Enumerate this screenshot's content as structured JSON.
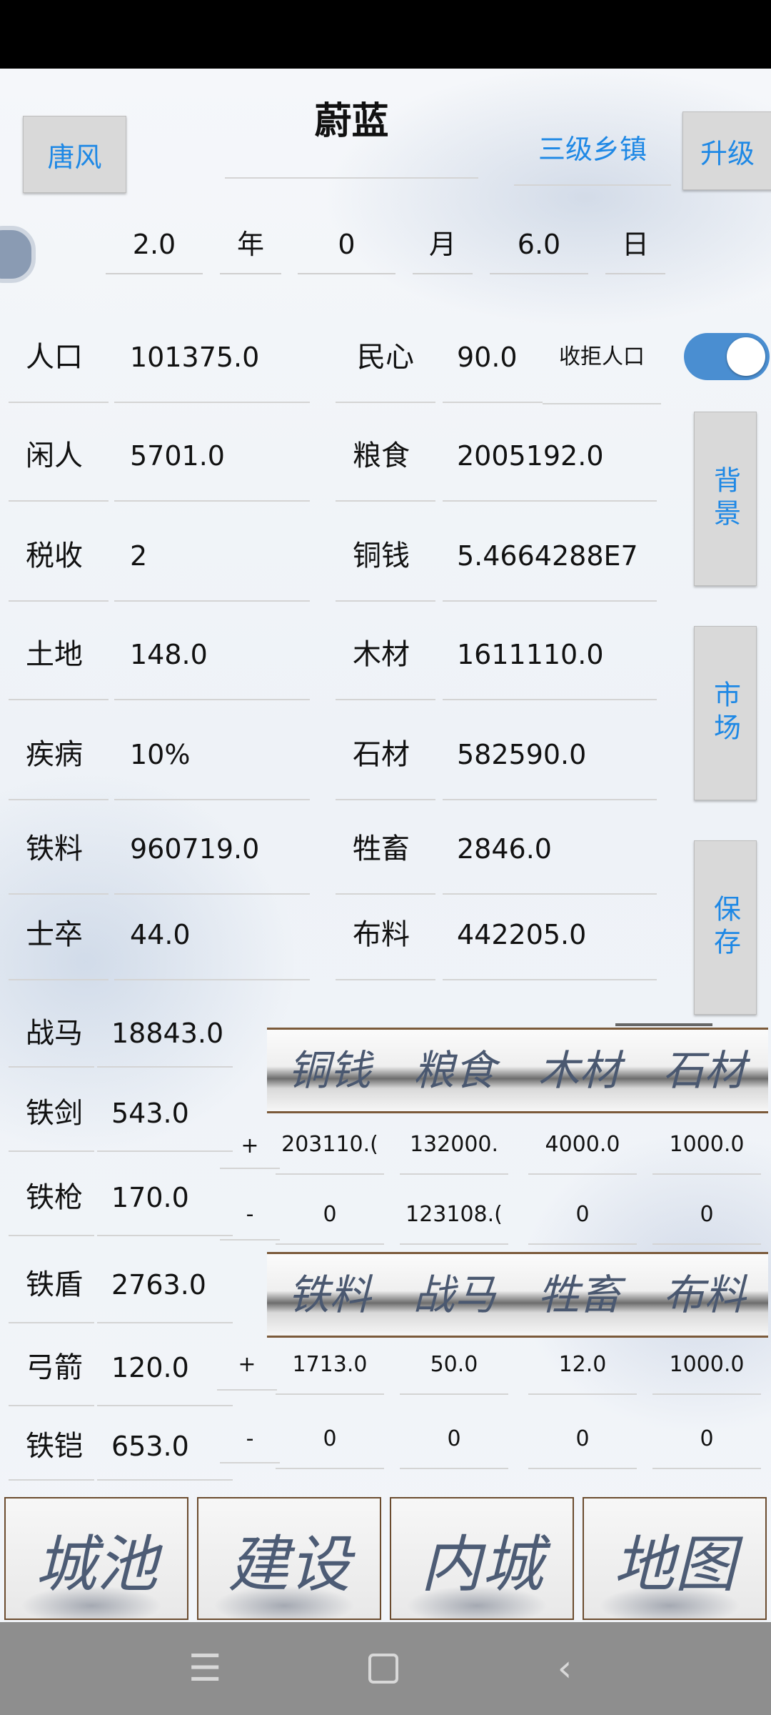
{
  "header": {
    "left_button": "唐风",
    "title": "蔚蓝",
    "town_level": "三级乡镇",
    "upgrade_button": "升级"
  },
  "date": {
    "year": "2.0",
    "year_unit": "年",
    "month": "0",
    "month_unit": "月",
    "day": "6.0",
    "day_unit": "日"
  },
  "stats": [
    {
      "label": "人口",
      "value": "101375.0",
      "label2": "民心",
      "value2": "90.0"
    },
    {
      "label": "闲人",
      "value": "5701.0",
      "label2": "粮食",
      "value2": "2005192.0"
    },
    {
      "label": "税收",
      "value": "2",
      "label2": "铜钱",
      "value2": "5.4664288E7"
    },
    {
      "label": "土地",
      "value": "148.0",
      "label2": "木材",
      "value2": "1611110.0"
    },
    {
      "label": "疾病",
      "value": "10%",
      "label2": "石材",
      "value2": "582590.0"
    },
    {
      "label": "铁料",
      "value": "960719.0",
      "label2": "牲畜",
      "value2": "2846.0"
    },
    {
      "label": "士卒",
      "value": "44.0",
      "label2": "布料",
      "value2": "442205.0"
    }
  ],
  "refuse_label": "收拒人口",
  "toggle_on": true,
  "side_buttons": [
    "背景",
    "市场",
    "保存"
  ],
  "military": [
    {
      "label": "战马",
      "value": "18843.0"
    },
    {
      "label": "铁剑",
      "value": "543.0"
    },
    {
      "label": "铁枪",
      "value": "170.0"
    },
    {
      "label": "铁盾",
      "value": "2763.0"
    },
    {
      "label": "弓箭",
      "value": "120.0"
    },
    {
      "label": "铁铠",
      "value": "653.0"
    }
  ],
  "market": {
    "banner1": [
      "铜钱",
      "粮食",
      "木材",
      "石材"
    ],
    "plus1": [
      "203110.(",
      "132000.",
      "4000.0",
      "1000.0"
    ],
    "minus1": [
      "0",
      "123108.(",
      "0",
      "0"
    ],
    "banner2": [
      "铁料",
      "战马",
      "牲畜",
      "布料"
    ],
    "plus2": [
      "1713.0",
      "50.0",
      "12.0",
      "1000.0"
    ],
    "minus2": [
      "0",
      "0",
      "0",
      "0"
    ],
    "plus_sign": "+",
    "minus_sign": "-"
  },
  "tiles": [
    "城池",
    "建设",
    "内城",
    "地图"
  ],
  "colors": {
    "accent": "#1e88e5",
    "toggle": "#4a8ed1"
  }
}
